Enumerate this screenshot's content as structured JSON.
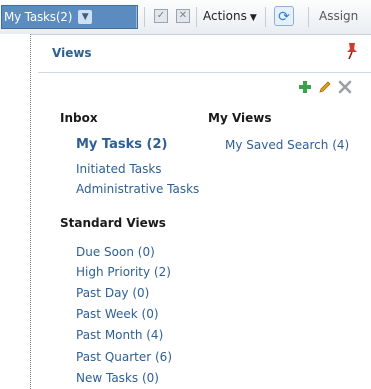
{
  "toolbar": {
    "tasks_label": "My Tasks(2)",
    "actions_label": "Actions",
    "assign_label": "Assign"
  },
  "views_panel": {
    "title": "Views",
    "inbox": {
      "heading": "Inbox",
      "items": [
        "My Tasks (2)",
        "Initiated Tasks",
        "Administrative Tasks"
      ]
    },
    "my_views": {
      "heading": "My Views",
      "items": [
        "My Saved Search (4)"
      ]
    },
    "standard_views": {
      "heading": "Standard Views",
      "items": [
        "Due Soon (0)",
        "High Priority (2)",
        "Past Day (0)",
        "Past Week (0)",
        "Past Month (4)",
        "Past Quarter (6)",
        "New Tasks (0)"
      ]
    }
  },
  "icons": [
    "chevron-down-icon",
    "checkbox-icon",
    "close-box-icon",
    "caret-down-icon",
    "refresh-icon",
    "pin-icon",
    "add-icon",
    "edit-icon",
    "delete-icon"
  ],
  "colors": {
    "accent": "#5b8bbf",
    "link": "#2d5f95",
    "add": "#3aa34a",
    "edit": "#e0a020",
    "pin": "#d23a2a"
  }
}
